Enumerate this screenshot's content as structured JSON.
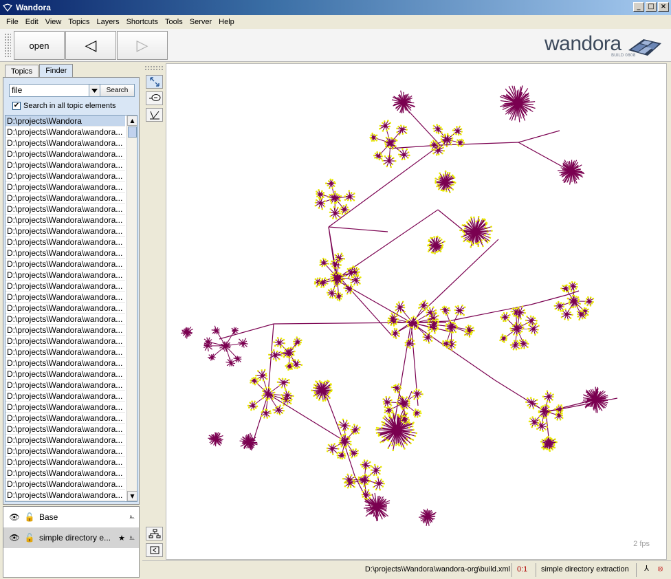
{
  "window": {
    "title": "Wandora"
  },
  "menu": [
    "File",
    "Edit",
    "View",
    "Topics",
    "Layers",
    "Shortcuts",
    "Tools",
    "Server",
    "Help"
  ],
  "toolbar": {
    "open_label": "open",
    "back_label": "◁",
    "forward_label": "▷"
  },
  "logo": {
    "wordmark": "wandora",
    "build": "BUILD 0808"
  },
  "left": {
    "tabs": [
      "Topics",
      "Finder"
    ],
    "active_tab": "Finder",
    "search": {
      "value": "file",
      "button": "Search",
      "checkbox_label": "Search in all topic elements",
      "checked": true
    },
    "results": [
      "D:\\projects\\Wandora",
      "D:\\projects\\Wandora\\wandora...",
      "D:\\projects\\Wandora\\wandora...",
      "D:\\projects\\Wandora\\wandora...",
      "D:\\projects\\Wandora\\wandora...",
      "D:\\projects\\Wandora\\wandora...",
      "D:\\projects\\Wandora\\wandora...",
      "D:\\projects\\Wandora\\wandora...",
      "D:\\projects\\Wandora\\wandora...",
      "D:\\projects\\Wandora\\wandora...",
      "D:\\projects\\Wandora\\wandora...",
      "D:\\projects\\Wandora\\wandora...",
      "D:\\projects\\Wandora\\wandora...",
      "D:\\projects\\Wandora\\wandora...",
      "D:\\projects\\Wandora\\wandora...",
      "D:\\projects\\Wandora\\wandora...",
      "D:\\projects\\Wandora\\wandora...",
      "D:\\projects\\Wandora\\wandora...",
      "D:\\projects\\Wandora\\wandora...",
      "D:\\projects\\Wandora\\wandora...",
      "D:\\projects\\Wandora\\wandora...",
      "D:\\projects\\Wandora\\wandora...",
      "D:\\projects\\Wandora\\wandora...",
      "D:\\projects\\Wandora\\wandora...",
      "D:\\projects\\Wandora\\wandora...",
      "D:\\projects\\Wandora\\wandora...",
      "D:\\projects\\Wandora\\wandora...",
      "D:\\projects\\Wandora\\wandora...",
      "D:\\projects\\Wandora\\wandora...",
      "D:\\projects\\Wandora\\wandora...",
      "D:\\projects\\Wandora\\wandora...",
      "D:\\projects\\Wandora\\wandora...",
      "D:\\projects\\Wandora\\wandora...",
      "D:\\projects\\Wandora\\wandora...",
      "D:\\projects\\Wandora\\wandora..."
    ],
    "layers": [
      {
        "name": "Base",
        "selected": false
      },
      {
        "name": "simple directory e...",
        "selected": true
      }
    ]
  },
  "graph": {
    "fps_label": "2 fps"
  },
  "status": {
    "file": "D:\\projects\\Wandora\\wandora-org\\build.xml",
    "count": "0:1",
    "layer": "simple directory extraction"
  },
  "colors": {
    "node": "#7a0050",
    "node_highlight": "#e8e800",
    "edge": "#7a0050"
  }
}
